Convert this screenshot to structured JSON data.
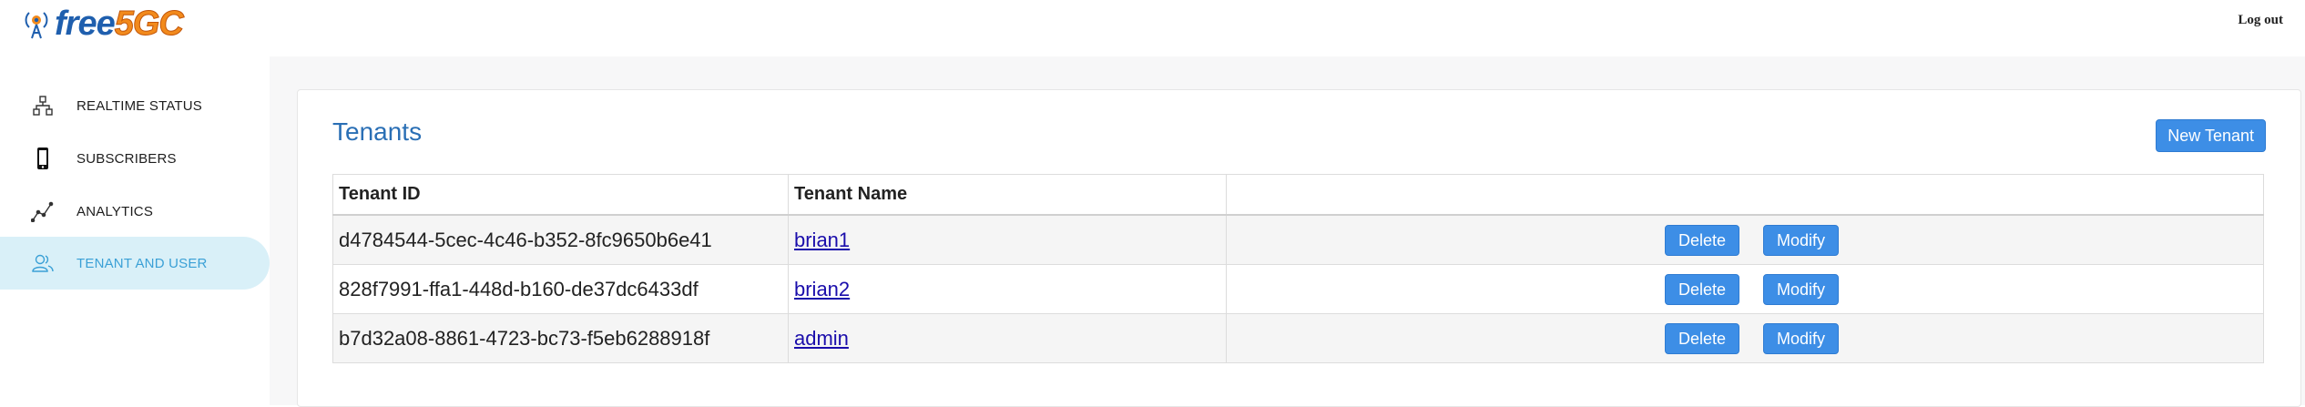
{
  "header": {
    "logo_text_free": "free",
    "logo_text_5gc": "5GC",
    "logout_label": "Log out"
  },
  "sidebar": {
    "items": [
      {
        "label": "REALTIME STATUS",
        "icon": "network-icon",
        "active": false
      },
      {
        "label": "SUBSCRIBERS",
        "icon": "phone-icon",
        "active": false
      },
      {
        "label": "ANALYTICS",
        "icon": "chart-line-icon",
        "active": false
      },
      {
        "label": "TENANT AND USER",
        "icon": "users-icon",
        "active": true
      }
    ]
  },
  "main": {
    "title": "Tenants",
    "new_button_label": "New Tenant",
    "table": {
      "headers": [
        "Tenant ID",
        "Tenant Name",
        ""
      ],
      "rows": [
        {
          "id": "d4784544-5cec-4c46-b352-8fc9650b6e41",
          "name": "brian1",
          "delete_label": "Delete",
          "modify_label": "Modify"
        },
        {
          "id": "828f7991-ffa1-448d-b160-de37dc6433df",
          "name": "brian2",
          "delete_label": "Delete",
          "modify_label": "Modify"
        },
        {
          "id": "b7d32a08-8861-4723-bc73-f5eb6288918f",
          "name": "admin",
          "delete_label": "Delete",
          "modify_label": "Modify"
        }
      ]
    }
  },
  "colors": {
    "accent": "#3d8ee6",
    "title_blue": "#2a6fb5",
    "active_bg": "#d9f0f8",
    "active_text": "#3aa0d6",
    "logo_blue": "#1f5fae",
    "logo_orange": "#f28a1c"
  }
}
